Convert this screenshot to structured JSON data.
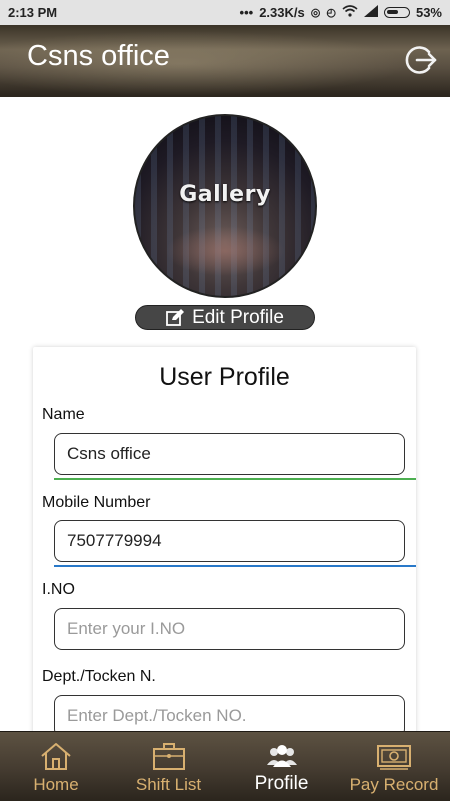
{
  "status_bar": {
    "time": "2:13 PM",
    "network_speed": "2.33K/s",
    "battery": "53%"
  },
  "header": {
    "title": "Csns office"
  },
  "profile_image": {
    "label": "Gallery"
  },
  "edit_profile": {
    "label": "Edit Profile"
  },
  "form": {
    "title": "User Profile",
    "fields": [
      {
        "label": "Name",
        "value": "Csns office",
        "placeholder": ""
      },
      {
        "label": "Mobile Number",
        "value": "7507779994",
        "placeholder": ""
      },
      {
        "label": "I.NO",
        "value": "",
        "placeholder": "Enter your I.NO"
      },
      {
        "label": "Dept./Tocken N.",
        "value": "",
        "placeholder": "Enter Dept./Tocken NO."
      }
    ]
  },
  "bottom_nav": {
    "items": [
      {
        "label": "Home",
        "icon": "home-icon"
      },
      {
        "label": "Shift List",
        "icon": "briefcase-icon"
      },
      {
        "label": "Profile",
        "icon": "users-icon"
      },
      {
        "label": "Pay Record",
        "icon": "money-icon"
      }
    ],
    "active": "Profile"
  },
  "colors": {
    "accent_text": "#d8b070",
    "name_underline": "#4caf50",
    "mobile_underline": "#2979c9",
    "header_dark": "#3a3327"
  }
}
